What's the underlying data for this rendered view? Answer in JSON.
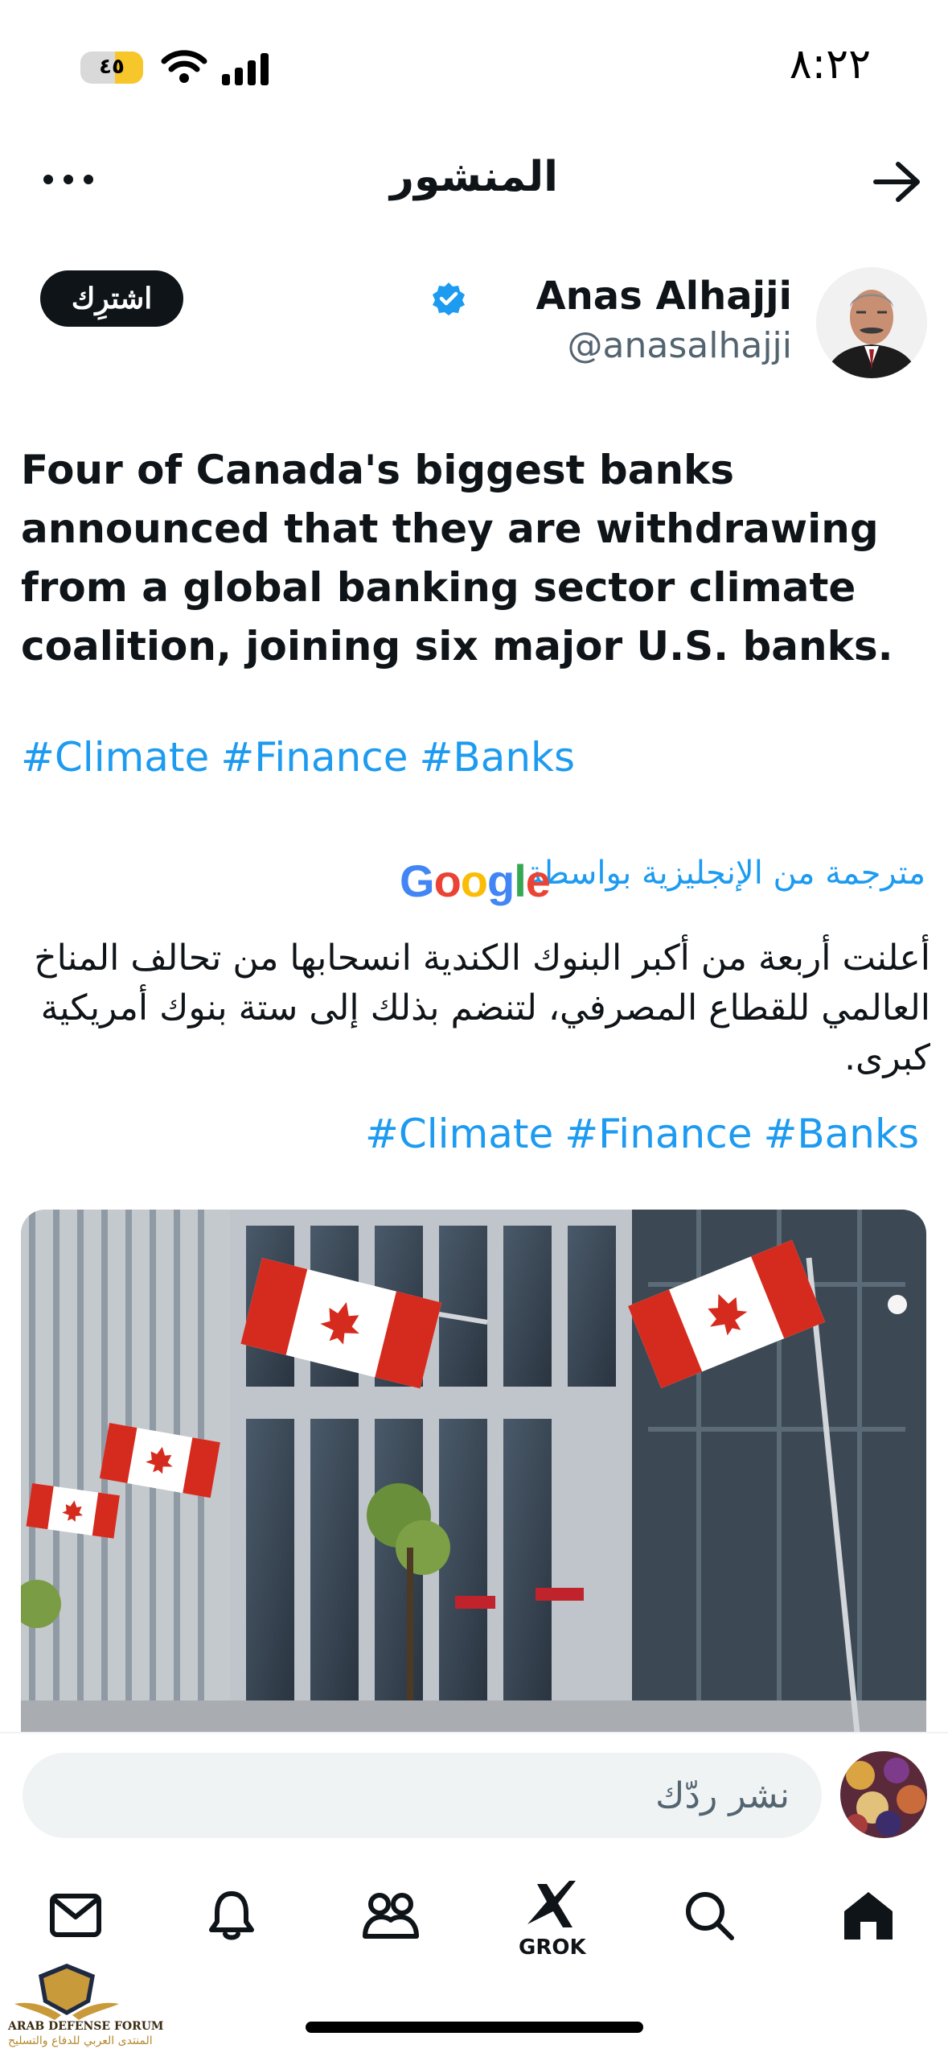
{
  "status_bar": {
    "time": "٨:٢٢",
    "battery_level": "٤٥",
    "battery_fraction": 0.45
  },
  "header": {
    "title": "المنشور",
    "menu_icon": "more-horizontal-icon",
    "back_icon": "arrow-right-icon"
  },
  "author": {
    "name": "Anas Alhajji",
    "handle": "@anasalhajji",
    "verified_icon": "verified-badge-icon",
    "subscribe_label": "اشترِك"
  },
  "post": {
    "text": "Four of Canada's biggest banks announced that they are withdrawing from a global banking sector climate coalition, joining six major U.S. banks.",
    "hashtags": [
      "#Climate",
      "#Finance",
      "#Banks"
    ],
    "translated_label": "مترجمة من الإنجليزية بواسطة",
    "translator_logo": "Google",
    "translation": "أعلنت أربعة من أكبر البنوك الكندية انسحابها من تحالف المناخ العالمي للقطاع المصرفي، لتنضم بذلك إلى ستة بنوك أمريكية كبرى.",
    "translated_hashtags": [
      "#Climate",
      "#Finance",
      "#Banks"
    ]
  },
  "reply": {
    "placeholder": "نشر ردّك"
  },
  "tab_bar": {
    "items": [
      {
        "icon": "mail-icon"
      },
      {
        "icon": "bell-icon"
      },
      {
        "icon": "communities-icon"
      },
      {
        "icon": "grok-icon",
        "label": "GROK"
      },
      {
        "icon": "search-icon"
      },
      {
        "icon": "home-icon"
      }
    ]
  },
  "watermark": {
    "name_en": "ARAB DEFENSE FORUM",
    "name_ar": "المنتدى العربي للدفاع والتسليح"
  },
  "colors": {
    "accent": "#1d9bf0",
    "text": "#0f1419",
    "muted": "#536471",
    "battery": "#f7c62a"
  }
}
